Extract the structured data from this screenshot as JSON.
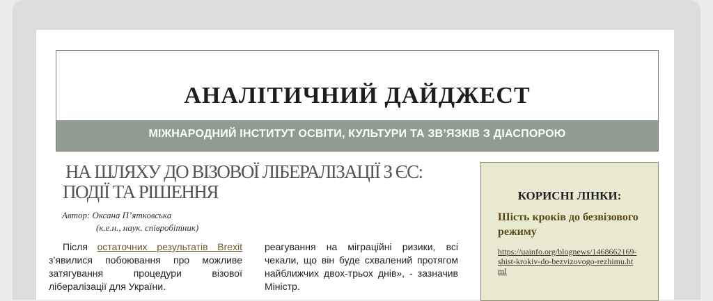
{
  "header": {
    "title": "АНАЛІТИЧНИЙ ДАЙДЖЕСТ",
    "subtitle": "МІЖНАРОДНИЙ ІНСТИТУТ ОСВІТИ, КУЛЬТУРИ ТА ЗВ’ЯЗКІВ З ДІАСПОРОЮ"
  },
  "article": {
    "title": "НА ШЛЯХУ ДО ВІЗОВОЇ ЛІБЕРАЛІЗАЦІЇ З ЄС: ПОДІЇ ТА РІШЕННЯ",
    "author": "Автор: Оксана П’ятковська",
    "credentials": "(к.е.н., наук. співробітник)",
    "col1_start": "Після ",
    "col1_link": "остаточних результатів Brexit",
    "col1_rest": " з’явилися побоювання про можливе затягування процедури візової лібералізації для України.",
    "col2": "реагування на міграційні ризики, всі чекали, що він буде схвалений протягом найближчих двох-трьох днів», - зазначив Міністр."
  },
  "sidebar": {
    "heading": "КОРИСНІ ЛІНКИ:",
    "link_title": "Шість кроків до безвізового режиму",
    "link_url": "https://uainfo.org/blognews/1468662169-shist-krokiv-do-bezvizovogo-rezhimu.html"
  }
}
